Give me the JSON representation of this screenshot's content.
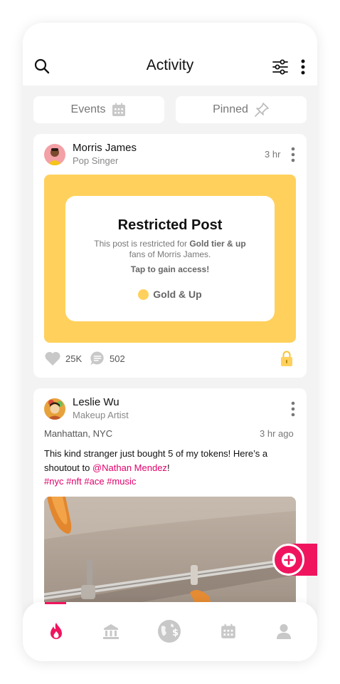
{
  "header": {
    "title": "Activity"
  },
  "tabs": [
    {
      "label": "Events",
      "icon": "calendar-icon"
    },
    {
      "label": "Pinned",
      "icon": "pin-icon"
    }
  ],
  "posts": [
    {
      "name": "Morris James",
      "role": "Pop Singer",
      "time": "3 hr",
      "restricted": {
        "title": "Restricted Post",
        "desc_pre": "This post is restricted for ",
        "desc_bold": "Gold tier & up",
        "desc_post": " fans of Morris James.",
        "tap": "Tap to gain access!",
        "tier": "Gold & Up",
        "tier_color": "#ffd15c"
      },
      "likes": "25K",
      "comments": "502"
    },
    {
      "name": "Leslie Wu",
      "role": "Makeup Artist",
      "location": "Manhattan, NYC",
      "time": "3 hr ago",
      "text_pre": "This kind stranger just bought 5 of my tokens! Here’s a shoutout to ",
      "mention": "@Nathan Mendez",
      "text_post": "!",
      "hashtags": "#nyc #nft #ace #music"
    }
  ],
  "nav": [
    "fire-icon",
    "bank-icon",
    "globe-dollar-icon",
    "calendar-icon",
    "profile-icon"
  ],
  "colors": {
    "accent": "#f0145f",
    "gold": "#ffd15c",
    "background": "#f3f3f3"
  }
}
